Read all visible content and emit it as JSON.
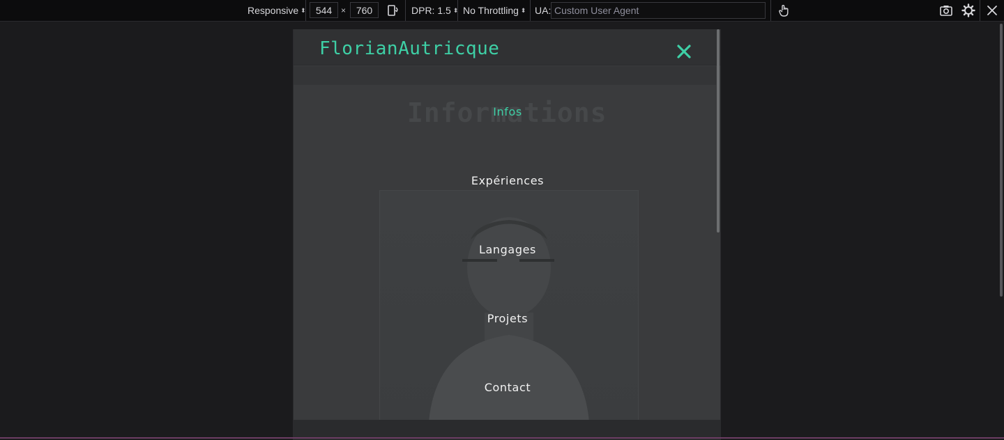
{
  "toolbar": {
    "device_select": "Responsive",
    "width_value": "544",
    "times": "×",
    "height_value": "760",
    "dpr_label": "DPR: 1.5",
    "throttling": "No Throttling",
    "ua_label": "UA:",
    "ua_placeholder": "Custom User Agent"
  },
  "site": {
    "brand": "FlorianAutricque",
    "background_heading": "Informations",
    "menu": [
      {
        "label": "Infos",
        "active": true
      },
      {
        "label": "Expériences",
        "active": false
      },
      {
        "label": "Langages",
        "active": false
      },
      {
        "label": "Projets",
        "active": false
      },
      {
        "label": "Contact",
        "active": false
      }
    ]
  },
  "colors": {
    "accent": "#3ed0a6",
    "toolbar_bg": "#0c0c0d",
    "page_bg": "#1b1b1d"
  },
  "icons": [
    "rotate-icon",
    "touch-icon",
    "screenshot-icon",
    "settings-icon",
    "close-icon"
  ]
}
